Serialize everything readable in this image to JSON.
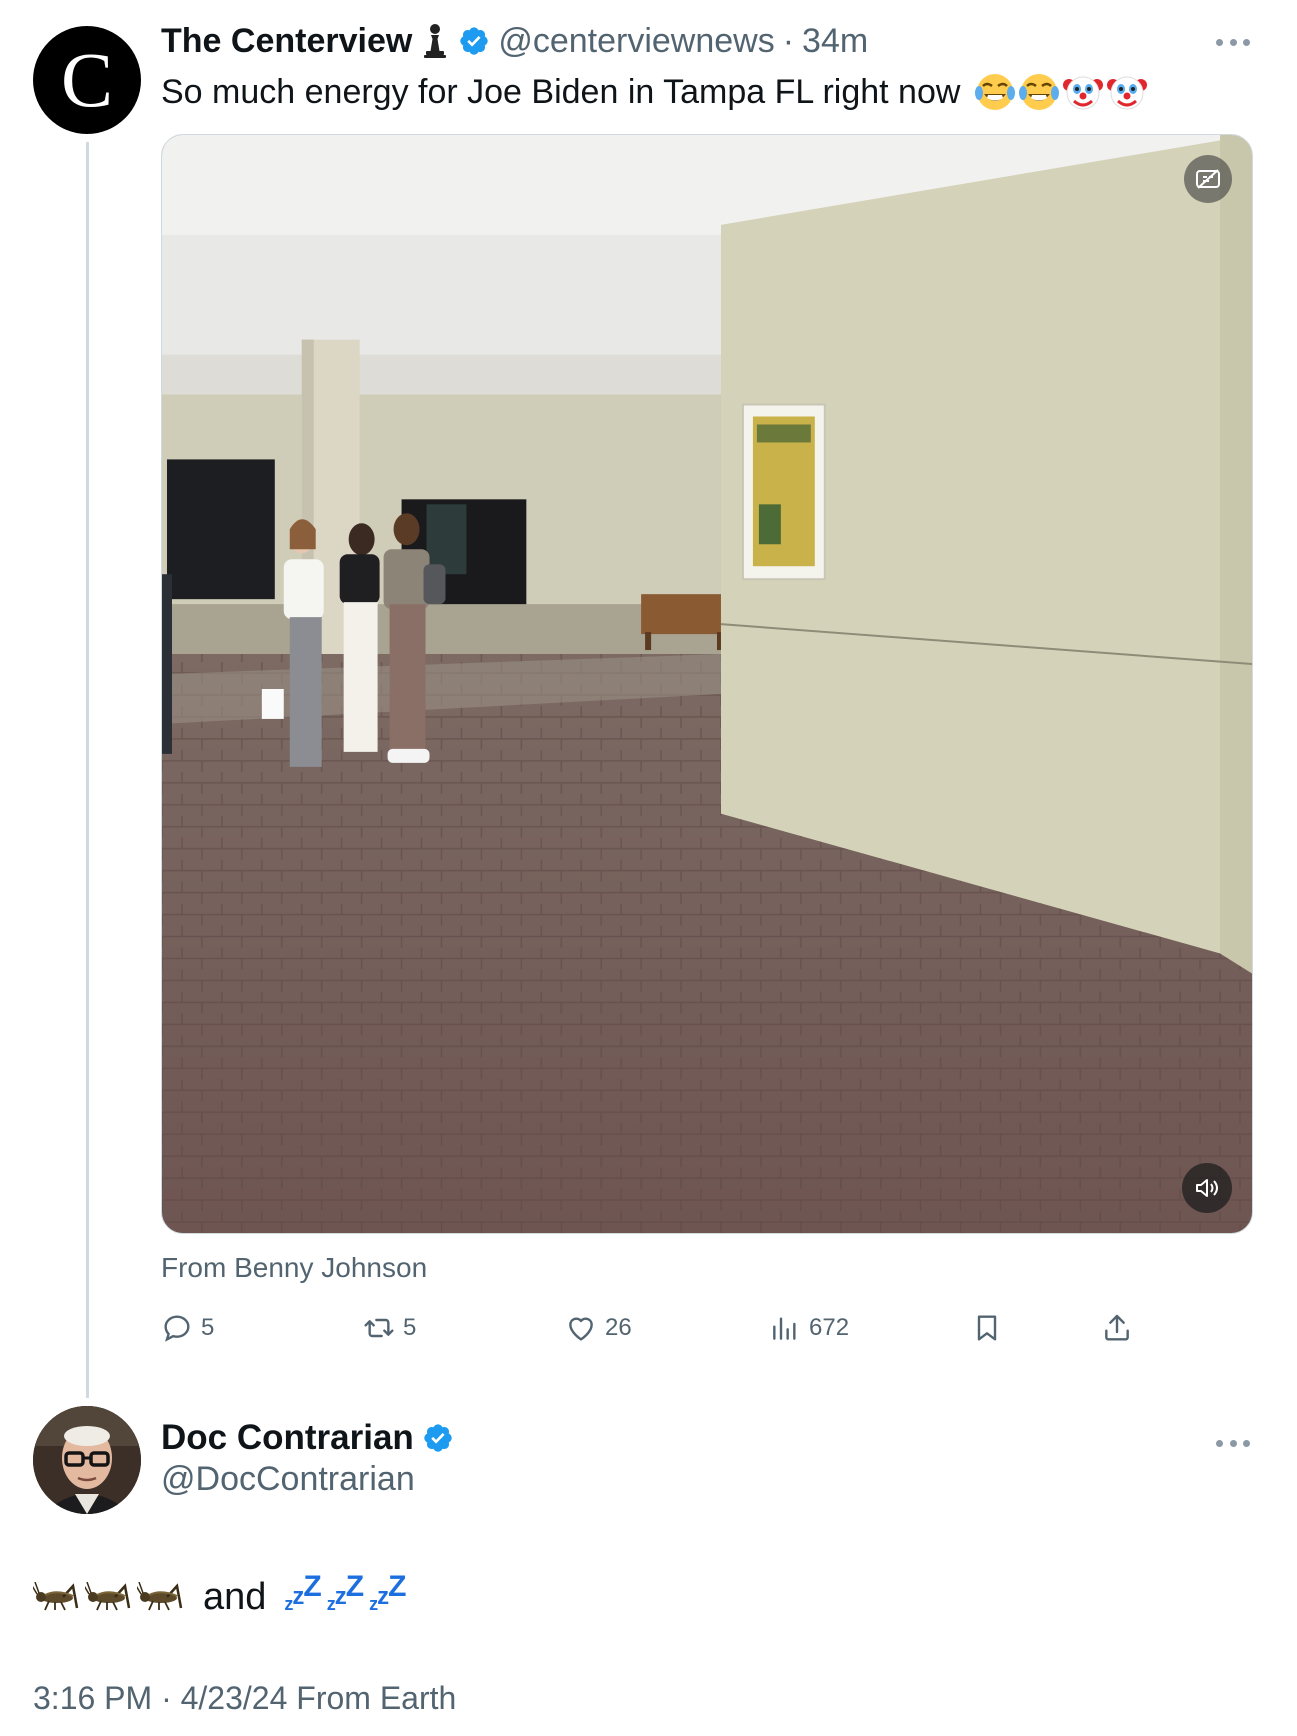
{
  "quoted_tweet": {
    "author_name": "The Centerview",
    "avatar_letter": "C",
    "handle": "@centerviewnews",
    "separator": "·",
    "time": "34m",
    "text": "So much energy for Joe Biden in Tampa FL right now",
    "emojis": [
      "face-with-tears-of-joy",
      "face-with-tears-of-joy",
      "clown-face",
      "clown-face"
    ],
    "attribution": "From Benny Johnson",
    "stats": {
      "replies": "5",
      "reposts": "5",
      "likes": "26",
      "views": "672"
    }
  },
  "main_tweet": {
    "author_name": "Doc Contrarian",
    "handle": "@DocContrarian",
    "text_connector": "and",
    "emojis_before": [
      "cricket",
      "cricket",
      "cricket"
    ],
    "emojis_after": [
      "zzz",
      "zzz",
      "zzz"
    ],
    "meta": "3:16 PM · 4/23/24 From Earth"
  },
  "colors": {
    "verified_blue": "#1d9bf0",
    "secondary_text": "#536471",
    "thread_line": "#cfd9de"
  }
}
